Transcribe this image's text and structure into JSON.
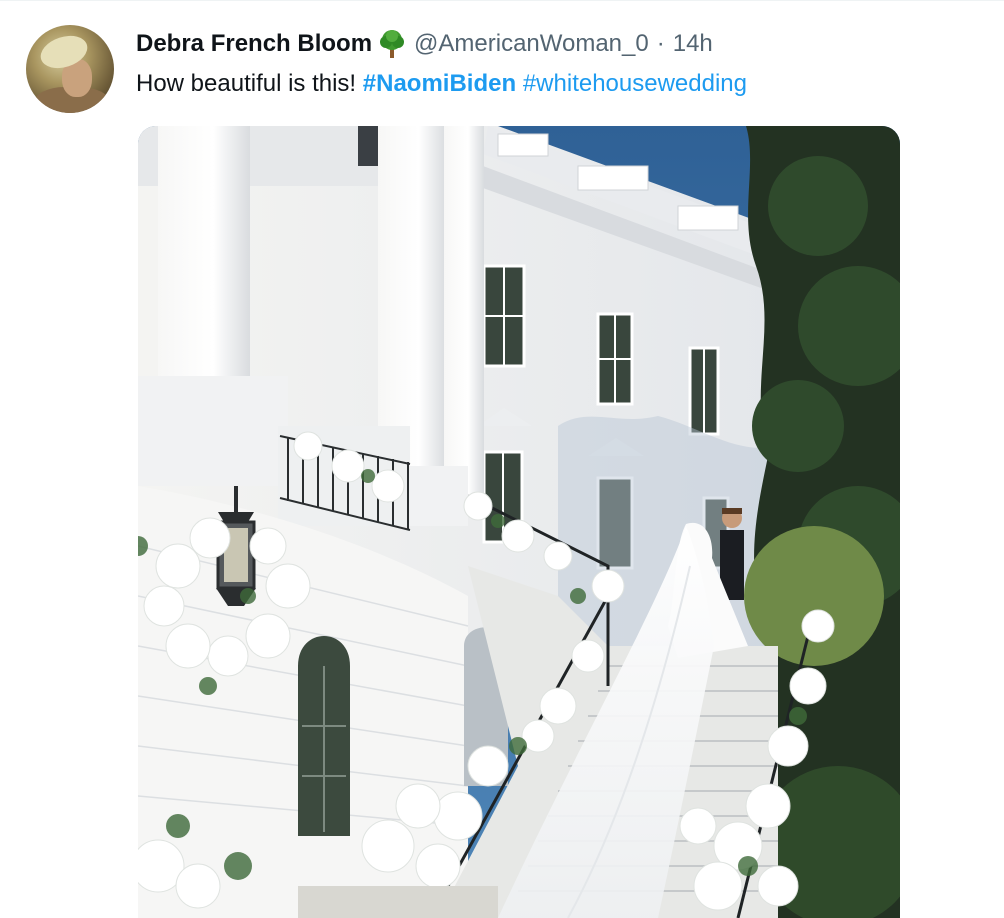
{
  "tweet": {
    "author": {
      "display_name": "Debra French Bloom",
      "badge_icon": "tree-emoji-icon",
      "handle": "@AmericanWoman_0",
      "separator": "·",
      "time": "14h"
    },
    "text": {
      "plain": "How beautiful is this! ",
      "hashtags": [
        "#NaomiBiden",
        "#whitehousewedding"
      ]
    },
    "media": {
      "type": "photo",
      "icon": "photo-image"
    }
  },
  "colors": {
    "link": "#1d9bf0",
    "secondary_text": "#536471",
    "primary_text": "#0f1419",
    "sky": "#2f6196"
  }
}
